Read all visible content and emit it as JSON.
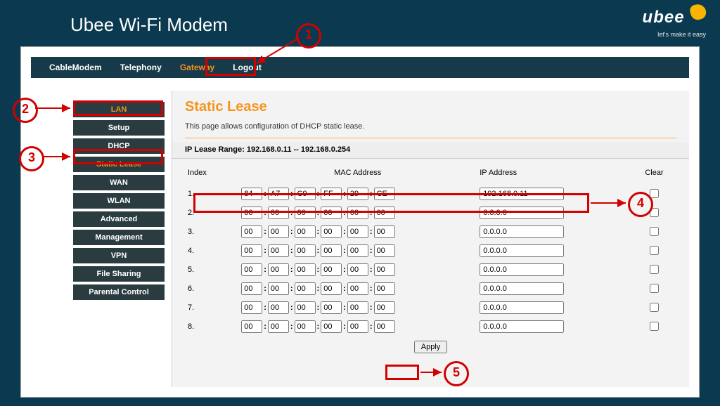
{
  "header": {
    "title": "Ubee Wi-Fi Modem",
    "brand": "ubee",
    "tagline": "let's make it easy"
  },
  "nav": {
    "items": [
      "CableModem",
      "Telephony",
      "Gateway",
      "Logout"
    ],
    "active": "Gateway"
  },
  "sidebar": {
    "items": [
      "LAN",
      "Setup",
      "DHCP",
      "Static Lease",
      "WAN",
      "WLAN",
      "Advanced",
      "Management",
      "VPN",
      "File Sharing",
      "Parental Control"
    ],
    "hi": [
      "LAN",
      "Static Lease"
    ]
  },
  "page": {
    "title": "Static Lease",
    "desc": "This page allows configuration of DHCP static lease.",
    "range_label": "IP Lease Range: 192.168.0.11 -- 192.168.0.254",
    "cols": {
      "index": "Index",
      "mac": "MAC Address",
      "ip": "IP Address",
      "clear": "Clear"
    },
    "apply": "Apply",
    "rows": [
      {
        "idx": "1.",
        "mac": [
          "84",
          "A7",
          "C9",
          "FF",
          "29",
          "CE"
        ],
        "ip": "192.168.0.11"
      },
      {
        "idx": "2.",
        "mac": [
          "00",
          "00",
          "00",
          "00",
          "00",
          "00"
        ],
        "ip": "0.0.0.0"
      },
      {
        "idx": "3.",
        "mac": [
          "00",
          "00",
          "00",
          "00",
          "00",
          "00"
        ],
        "ip": "0.0.0.0"
      },
      {
        "idx": "4.",
        "mac": [
          "00",
          "00",
          "00",
          "00",
          "00",
          "00"
        ],
        "ip": "0.0.0.0"
      },
      {
        "idx": "5.",
        "mac": [
          "00",
          "00",
          "00",
          "00",
          "00",
          "00"
        ],
        "ip": "0.0.0.0"
      },
      {
        "idx": "6.",
        "mac": [
          "00",
          "00",
          "00",
          "00",
          "00",
          "00"
        ],
        "ip": "0.0.0.0"
      },
      {
        "idx": "7.",
        "mac": [
          "00",
          "00",
          "00",
          "00",
          "00",
          "00"
        ],
        "ip": "0.0.0.0"
      },
      {
        "idx": "8.",
        "mac": [
          "00",
          "00",
          "00",
          "00",
          "00",
          "00"
        ],
        "ip": "0.0.0.0"
      }
    ]
  },
  "annotations": [
    "1",
    "2",
    "3",
    "4",
    "5"
  ]
}
